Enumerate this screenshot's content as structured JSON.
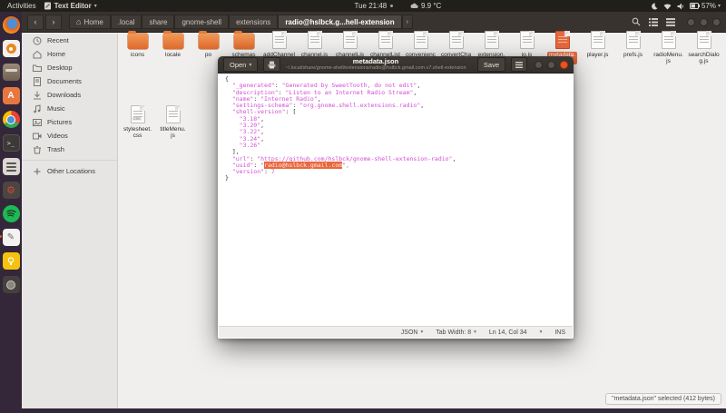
{
  "topbar": {
    "activities": "Activities",
    "app_menu": "Text Editor",
    "clock": "Tue 21:48",
    "weather": "9.9 °C",
    "battery_percent": "57%"
  },
  "dock": {
    "items": [
      {
        "id": "firefox",
        "label": "Firefox",
        "running": false
      },
      {
        "id": "rhythmbox",
        "label": "Rhythmbox",
        "running": false
      },
      {
        "id": "files",
        "label": "Files",
        "running": false
      },
      {
        "id": "ubuntu-software",
        "label": "Ubuntu Software",
        "running": false
      },
      {
        "id": "chrome",
        "label": "Google Chrome",
        "running": false
      },
      {
        "id": "terminal",
        "label": "Terminal",
        "running": false
      },
      {
        "id": "tweaks",
        "label": "Tweaks",
        "running": false
      },
      {
        "id": "system-settings",
        "label": "Settings",
        "running": false
      },
      {
        "id": "spotify",
        "label": "Spotify",
        "running": false
      },
      {
        "id": "text-editor",
        "label": "Text Editor",
        "running": true
      },
      {
        "id": "notes",
        "label": "Notes",
        "running": false
      },
      {
        "id": "screenshot",
        "label": "Screenshot",
        "running": false
      }
    ]
  },
  "files": {
    "breadcrumb": [
      "Home",
      ".local",
      "share",
      "gnome-shell",
      "extensions",
      "radio@hslbck.g...hell-extension"
    ],
    "sidebar": {
      "items": [
        {
          "icon": "clock-icon",
          "label": "Recent"
        },
        {
          "icon": "home-icon",
          "label": "Home"
        },
        {
          "icon": "folder-icon",
          "label": "Desktop"
        },
        {
          "icon": "document-icon",
          "label": "Documents"
        },
        {
          "icon": "download-icon",
          "label": "Downloads"
        },
        {
          "icon": "music-icon",
          "label": "Music"
        },
        {
          "icon": "photo-icon",
          "label": "Pictures"
        },
        {
          "icon": "video-icon",
          "label": "Videos"
        },
        {
          "icon": "trash-icon",
          "label": "Trash"
        }
      ],
      "other_locations": "Other Locations"
    },
    "grid_row1": [
      {
        "label": "icons",
        "type": "folder",
        "selected": false
      },
      {
        "label": "locale",
        "type": "folder",
        "selected": false
      },
      {
        "label": "po",
        "type": "folder",
        "selected": false
      },
      {
        "label": "schemas",
        "type": "folder",
        "selected": false
      },
      {
        "label": "addChannel\nDialog.js",
        "type": "file",
        "selected": false
      },
      {
        "label": "channel.js",
        "type": "file",
        "selected": false
      },
      {
        "label": "channelLis\nt.js",
        "type": "file",
        "selected": false
      },
      {
        "label": "channelList\nDialog.js",
        "type": "file",
        "selected": false
      },
      {
        "label": "convenienc\ne.js",
        "type": "file",
        "selected": false
      },
      {
        "label": "convertCha\nnnels.js",
        "type": "file",
        "selected": false
      },
      {
        "label": "extension.\njs",
        "type": "file",
        "selected": false
      },
      {
        "label": "io.js",
        "type": "file",
        "selected": false
      },
      {
        "label": "metadata.\njson",
        "type": "file",
        "selected": true
      },
      {
        "label": "player.js",
        "type": "file",
        "selected": false
      },
      {
        "label": "prefs.js",
        "type": "file",
        "selected": false
      },
      {
        "label": "radioMenu.\njs",
        "type": "file",
        "selected": false
      },
      {
        "label": "searchDialo\ng.js",
        "type": "file",
        "selected": false
      }
    ],
    "grid_row2": [
      {
        "label": "stylesheet.\ncss",
        "type": "css",
        "selected": false
      },
      {
        "label": "titleMenu.\njs",
        "type": "file",
        "selected": false
      }
    ],
    "status_bubble": "\"metadata.json\" selected (412 bytes)"
  },
  "editor": {
    "open_button": "Open",
    "title": "metadata.json",
    "subtitle": "~/.local/share/gnome-shell/extensions/radio@hslbck.gmail.com.v7.shell-extension",
    "save_button": "Save",
    "lines": [
      "{",
      "  \"_generated\": \"Generated by SweetTooth, do not edit\",",
      "  \"description\": \"Listen to an Internet Radio Stream\",",
      "  \"name\": \"Internet Radio\",",
      "  \"settings-schema\": \"org.gnome.shell.extensions.radio\",",
      "  \"shell-version\": [",
      "    \"3.18\",",
      "    \"3.20\",",
      "    \"3.22\",",
      "    \"3.24\",",
      "    \"3.26\"",
      "  ],",
      "  \"url\": \"https://github.com/hslbck/gnome-shell-extension-radio\",",
      "  \"uuid\": \"radio@hslbck.gmail.com\",",
      "  \"version\": 7",
      "}"
    ],
    "selection": {
      "line": 14,
      "text": "radio@hslbck.gmail.com"
    },
    "statusbar": {
      "language": "JSON",
      "tab_width": "Tab Width: 8",
      "position": "Ln 14, Col 34",
      "mode": "INS"
    }
  },
  "colors": {
    "accent_orange": "#e8683f",
    "string_magenta": "#d24fd2",
    "folder_orange": "#e9772f",
    "close_button": "#e95420"
  }
}
